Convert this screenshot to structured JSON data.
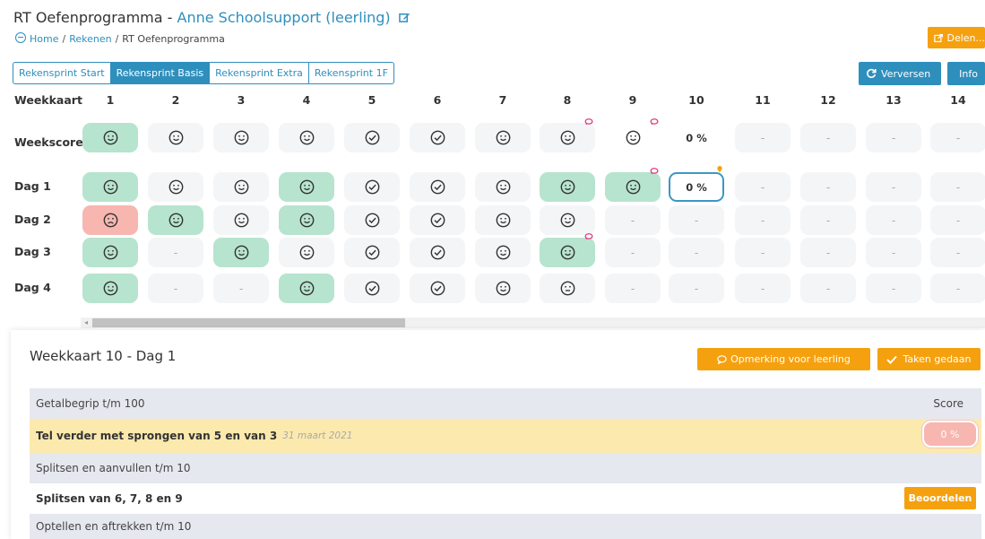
{
  "page": {
    "title_prefix": "RT Oefenprogramma - ",
    "student": "Anne Schoolsupport (leerling)",
    "edit_icon": "pencil-square-icon"
  },
  "breadcrumb": {
    "home": "Home",
    "rekenen": "Rekenen",
    "current": "RT Oefenprogramma",
    "sep": "/"
  },
  "buttons": {
    "delen": "Delen...",
    "verversen": "Verversen",
    "info": "Info"
  },
  "tabs": [
    "Rekensprint Start",
    "Rekensprint Basis",
    "Rekensprint Extra",
    "Rekensprint 1F"
  ],
  "active_tab": "Rekensprint Basis",
  "grid": {
    "header_label": "Weekkaart",
    "columns": [
      "1",
      "2",
      "3",
      "4",
      "5",
      "6",
      "7",
      "8",
      "9",
      "10",
      "11",
      "12",
      "13",
      "14"
    ],
    "rows": [
      {
        "label": "Weekscore",
        "cells": [
          {
            "t": "smile",
            "bg": "green"
          },
          {
            "t": "smile"
          },
          {
            "t": "smile"
          },
          {
            "t": "smile"
          },
          {
            "t": "check"
          },
          {
            "t": "check"
          },
          {
            "t": "smile"
          },
          {
            "t": "smile",
            "badge": "comment"
          },
          {
            "t": "smile",
            "badge": "comment",
            "bg": "bare"
          },
          {
            "t": "pct",
            "v": "0 %",
            "bg": "bare"
          },
          {
            "t": "dash",
            "v": "-"
          },
          {
            "t": "dash",
            "v": "-"
          },
          {
            "t": "dash",
            "v": "-"
          },
          {
            "t": "dash",
            "v": "-"
          }
        ]
      },
      {
        "label": "Dag 1",
        "cells": [
          {
            "t": "smile",
            "bg": "green"
          },
          {
            "t": "smile"
          },
          {
            "t": "smile"
          },
          {
            "t": "smile",
            "bg": "green"
          },
          {
            "t": "check"
          },
          {
            "t": "check"
          },
          {
            "t": "smile"
          },
          {
            "t": "smile",
            "bg": "green"
          },
          {
            "t": "smile",
            "bg": "green",
            "badge": "comment"
          },
          {
            "t": "pct",
            "v": "0 %",
            "bg": "outline",
            "badge": "pin"
          },
          {
            "t": "dash",
            "v": "-"
          },
          {
            "t": "dash",
            "v": "-"
          },
          {
            "t": "dash",
            "v": "-"
          },
          {
            "t": "dash",
            "v": "-"
          }
        ]
      },
      {
        "label": "Dag 2",
        "cells": [
          {
            "t": "sad",
            "bg": "red"
          },
          {
            "t": "smile",
            "bg": "green"
          },
          {
            "t": "smile"
          },
          {
            "t": "smile",
            "bg": "green"
          },
          {
            "t": "check"
          },
          {
            "t": "check"
          },
          {
            "t": "smile"
          },
          {
            "t": "smile"
          },
          {
            "t": "dash",
            "v": "-"
          },
          {
            "t": "dash",
            "v": "-"
          },
          {
            "t": "dash",
            "v": "-"
          },
          {
            "t": "dash",
            "v": "-"
          },
          {
            "t": "dash",
            "v": "-"
          },
          {
            "t": "dash",
            "v": "-"
          }
        ]
      },
      {
        "label": "Dag 3",
        "cells": [
          {
            "t": "smile",
            "bg": "green"
          },
          {
            "t": "dash",
            "v": "-"
          },
          {
            "t": "smile",
            "bg": "green"
          },
          {
            "t": "smile"
          },
          {
            "t": "check"
          },
          {
            "t": "check"
          },
          {
            "t": "smile"
          },
          {
            "t": "smile",
            "bg": "green",
            "badge": "comment"
          },
          {
            "t": "dash",
            "v": "-"
          },
          {
            "t": "dash",
            "v": "-"
          },
          {
            "t": "dash",
            "v": "-"
          },
          {
            "t": "dash",
            "v": "-"
          },
          {
            "t": "dash",
            "v": "-"
          },
          {
            "t": "dash",
            "v": "-"
          }
        ]
      },
      {
        "label": "Dag 4",
        "cells": [
          {
            "t": "smile",
            "bg": "green"
          },
          {
            "t": "dash",
            "v": "-"
          },
          {
            "t": "dash",
            "v": "-"
          },
          {
            "t": "smile",
            "bg": "green"
          },
          {
            "t": "check"
          },
          {
            "t": "check"
          },
          {
            "t": "smile"
          },
          {
            "t": "neutral"
          },
          {
            "t": "dash",
            "v": "-"
          },
          {
            "t": "dash",
            "v": "-"
          },
          {
            "t": "dash",
            "v": "-"
          },
          {
            "t": "dash",
            "v": "-"
          },
          {
            "t": "dash",
            "v": "-"
          },
          {
            "t": "dash",
            "v": "-"
          }
        ]
      }
    ]
  },
  "colors": {
    "accent": "#2e8fbd",
    "orange": "#f5a10f",
    "green_cell": "#b7e4cf",
    "red_cell": "#f7b6b0",
    "comment_badge": "#e0357a"
  },
  "panel": {
    "title": "Weekkaart 10 - Dag 1",
    "opmerking_button": "Opmerking voor leerling",
    "taken_button": "Taken gedaan",
    "group1": "Getalbegrip t/m 100",
    "score_header": "Score",
    "task1": "Tel verder met sprongen van 5 en van 3",
    "task1_date": "31 maart 2021",
    "task1_score": "0 %",
    "group2": "Splitsen en aanvullen t/m 10",
    "task2": "Splitsen van 6, 7, 8 en 9",
    "task2_button": "Beoordelen",
    "group3": "Optellen en aftrekken t/m 10"
  }
}
